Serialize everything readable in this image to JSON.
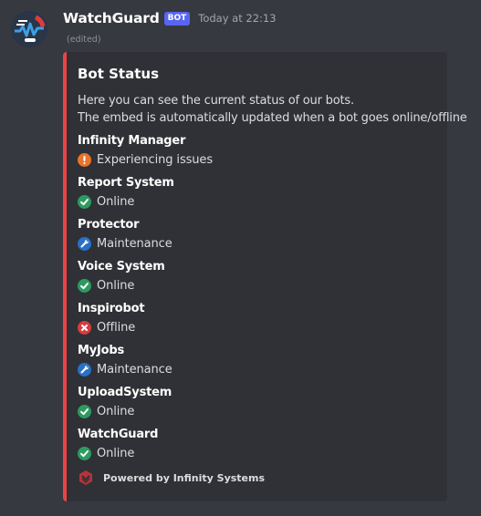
{
  "author": {
    "username": "WatchGuard",
    "bot_tag": "BOT",
    "timestamp": "Today at 22:13",
    "edited_label": "(edited)"
  },
  "embed": {
    "accent_color": "#ed4245",
    "title": "Bot Status",
    "description_lines": [
      "Here you can see the current status of our bots.",
      "The embed is automatically updated when a bot goes online/offline"
    ],
    "fields": [
      {
        "name": "Infinity Manager",
        "status": "Experiencing issues",
        "icon": "warning-icon"
      },
      {
        "name": "Report System",
        "status": "Online",
        "icon": "check-icon"
      },
      {
        "name": "Protector",
        "status": "Maintenance",
        "icon": "wrench-icon"
      },
      {
        "name": "Voice System",
        "status": "Online",
        "icon": "check-icon"
      },
      {
        "name": "Inspirobot",
        "status": "Offline",
        "icon": "cross-icon"
      },
      {
        "name": "MyJobs",
        "status": "Maintenance",
        "icon": "wrench-icon"
      },
      {
        "name": "UploadSystem",
        "status": "Online",
        "icon": "check-icon"
      },
      {
        "name": "WatchGuard",
        "status": "Online",
        "icon": "check-icon"
      }
    ],
    "footer": {
      "text": "Powered by Infinity Systems",
      "icon": "infinity-logo-icon"
    }
  },
  "colors": {
    "background": "#36393f",
    "embed_background": "#2f3136",
    "bot_tag": "#5865f2",
    "online": "#2d9b5f",
    "offline": "#d83c3e",
    "maintenance": "#2870c8",
    "issues": "#e8742a"
  }
}
